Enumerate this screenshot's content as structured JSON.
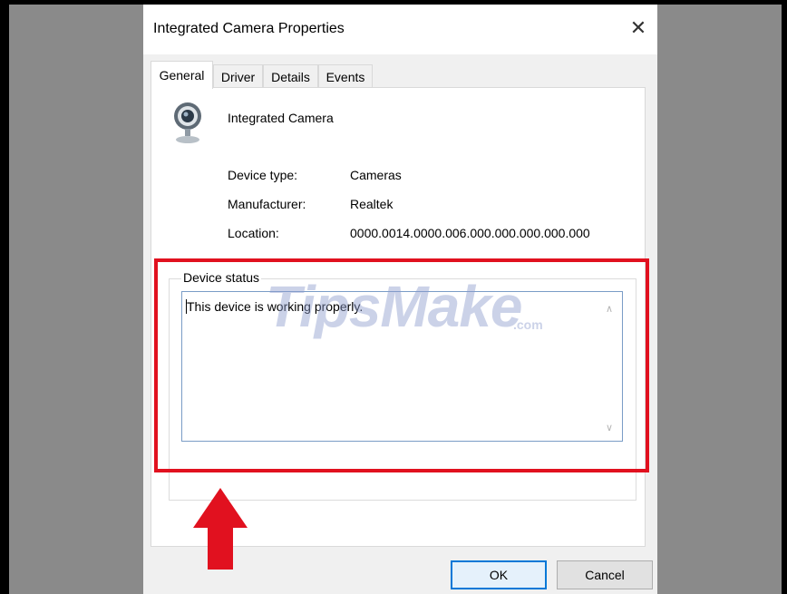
{
  "dialog": {
    "title": "Integrated Camera Properties",
    "close_glyph": "✕"
  },
  "tabs": [
    {
      "label": "General",
      "active": true
    },
    {
      "label": "Driver",
      "active": false
    },
    {
      "label": "Details",
      "active": false
    },
    {
      "label": "Events",
      "active": false
    }
  ],
  "device": {
    "name": "Integrated Camera",
    "icon": "webcam-icon"
  },
  "properties": [
    {
      "label": "Device type:",
      "value": "Cameras"
    },
    {
      "label": "Manufacturer:",
      "value": "Realtek"
    },
    {
      "label": "Location:",
      "value": "0000.0014.0000.006.000.000.000.000.000"
    }
  ],
  "device_status": {
    "title": "Device status",
    "text": "This device is working properly.",
    "scroll_up_glyph": "∧",
    "scroll_down_glyph": "∨"
  },
  "watermark": {
    "main": "TipsMake",
    "suffix": ".com"
  },
  "buttons": {
    "ok_label": "OK",
    "cancel_label": "Cancel"
  },
  "colors": {
    "highlight": "#e1111f",
    "backdrop": "#8a8a8a",
    "focus_border": "#0078d7"
  }
}
